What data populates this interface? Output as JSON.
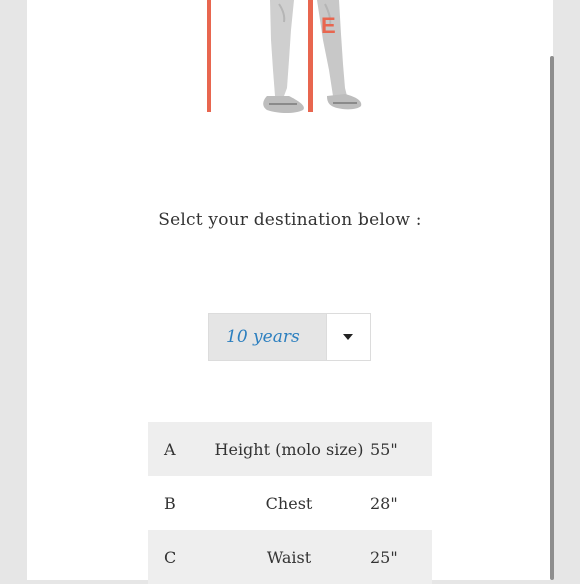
{
  "figure": {
    "marker_letter": "E",
    "marker_color": "#e8664f",
    "icon": "child-legs-illustration-icon"
  },
  "prompt": "Selct your destination below :",
  "size_select": {
    "value": "10 years",
    "dropdown_icon": "caret-down-icon"
  },
  "measurements": [
    {
      "letter": "A",
      "label": "Height (molo size)",
      "value": "55\""
    },
    {
      "letter": "B",
      "label": "Chest",
      "value": "28\""
    },
    {
      "letter": "C",
      "label": "Waist",
      "value": "25\""
    }
  ]
}
